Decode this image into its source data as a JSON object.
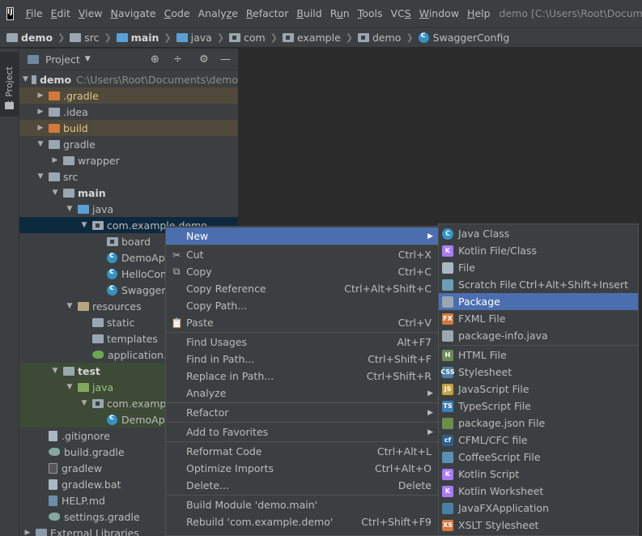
{
  "menubar": {
    "items": [
      {
        "prefix": "",
        "u": "F",
        "rest": "ile"
      },
      {
        "prefix": "",
        "u": "E",
        "rest": "dit"
      },
      {
        "prefix": "",
        "u": "V",
        "rest": "iew"
      },
      {
        "prefix": "",
        "u": "N",
        "rest": "avigate"
      },
      {
        "prefix": "",
        "u": "C",
        "rest": "ode"
      },
      {
        "prefix": "Analy",
        "u": "z",
        "rest": "e"
      },
      {
        "prefix": "",
        "u": "R",
        "rest": "efactor"
      },
      {
        "prefix": "",
        "u": "B",
        "rest": "uild"
      },
      {
        "prefix": "R",
        "u": "u",
        "rest": "n"
      },
      {
        "prefix": "",
        "u": "T",
        "rest": "ools"
      },
      {
        "prefix": "VC",
        "u": "S",
        "rest": ""
      },
      {
        "prefix": "",
        "u": "W",
        "rest": "indow"
      },
      {
        "prefix": "",
        "u": "H",
        "rest": "elp"
      }
    ],
    "window_title": "demo [C:\\Users\\Root\\Documents\\demo]"
  },
  "breadcrumb": [
    "demo",
    "src",
    "main",
    "java",
    "com",
    "example",
    "demo",
    "SwaggerConfig"
  ],
  "tool_window": {
    "tab_label": "1: Project"
  },
  "project_panel": {
    "title": "Project",
    "tree": [
      {
        "label": "demo",
        "path": "C:\\Users\\Root\\Documents\\demo"
      },
      {
        "label": ".gradle"
      },
      {
        "label": ".idea"
      },
      {
        "label": "build"
      },
      {
        "label": "gradle"
      },
      {
        "label": "wrapper"
      },
      {
        "label": "src"
      },
      {
        "label": "main"
      },
      {
        "label": "java"
      },
      {
        "label": "com.example.demo"
      },
      {
        "label": "board"
      },
      {
        "label": "DemoApp"
      },
      {
        "label": "HelloCont"
      },
      {
        "label": "SwaggerC"
      },
      {
        "label": "resources"
      },
      {
        "label": "static"
      },
      {
        "label": "templates"
      },
      {
        "label": "application.p"
      },
      {
        "label": "test"
      },
      {
        "label": "java"
      },
      {
        "label": "com.example"
      },
      {
        "label": "DemoApp"
      },
      {
        "label": ".gitignore"
      },
      {
        "label": "build.gradle"
      },
      {
        "label": "gradlew"
      },
      {
        "label": "gradlew.bat"
      },
      {
        "label": "HELP.md"
      },
      {
        "label": "settings.gradle"
      },
      {
        "label": "External Libraries"
      }
    ]
  },
  "context_menu": {
    "items": [
      {
        "label": "New",
        "shortcut": "",
        "icon": ""
      },
      {
        "label": "Cut",
        "shortcut": "Ctrl+X",
        "icon": "✂"
      },
      {
        "label": "Copy",
        "shortcut": "Ctrl+C",
        "icon": "⧉"
      },
      {
        "label": "Copy Reference",
        "shortcut": "Ctrl+Alt+Shift+C",
        "icon": ""
      },
      {
        "label": "Copy Path...",
        "shortcut": "",
        "icon": ""
      },
      {
        "label": "Paste",
        "shortcut": "Ctrl+V",
        "icon": "📋"
      },
      {
        "label": "Find Usages",
        "shortcut": "Alt+F7",
        "icon": ""
      },
      {
        "label": "Find in Path...",
        "shortcut": "Ctrl+Shift+F",
        "icon": ""
      },
      {
        "label": "Replace in Path...",
        "shortcut": "Ctrl+Shift+R",
        "icon": ""
      },
      {
        "label": "Analyze",
        "shortcut": "",
        "icon": ""
      },
      {
        "label": "Refactor",
        "shortcut": "",
        "icon": ""
      },
      {
        "label": "Add to Favorites",
        "shortcut": "",
        "icon": ""
      },
      {
        "label": "Reformat Code",
        "shortcut": "Ctrl+Alt+L",
        "icon": ""
      },
      {
        "label": "Optimize Imports",
        "shortcut": "Ctrl+Alt+O",
        "icon": ""
      },
      {
        "label": "Delete...",
        "shortcut": "Delete",
        "icon": ""
      },
      {
        "label": "Build Module 'demo.main'",
        "shortcut": "",
        "icon": ""
      },
      {
        "label": "Rebuild 'com.example.demo'",
        "shortcut": "Ctrl+Shift+F9",
        "icon": ""
      }
    ]
  },
  "new_submenu": {
    "items": [
      {
        "label": "Java Class",
        "shortcut": "",
        "icon": "java-class-icon",
        "color": "#3592c4",
        "glyph": "C"
      },
      {
        "label": "Kotlin File/Class",
        "shortcut": "",
        "icon": "kotlin-file-icon",
        "color": "#a97bff",
        "glyph": "K"
      },
      {
        "label": "File",
        "shortcut": "",
        "icon": "file-icon",
        "color": "#a9b7c6",
        "glyph": ""
      },
      {
        "label": "Scratch File",
        "shortcut": "Ctrl+Alt+Shift+Insert",
        "icon": "scratch-file-icon",
        "color": "#6a9fb5",
        "glyph": ""
      },
      {
        "label": "Package",
        "shortcut": "",
        "icon": "package-icon",
        "color": "#9aa7b0",
        "glyph": ""
      },
      {
        "label": "FXML File",
        "shortcut": "",
        "icon": "fxml-file-icon",
        "color": "#d3793d",
        "glyph": "FX"
      },
      {
        "label": "package-info.java",
        "shortcut": "",
        "icon": "package-info-icon",
        "color": "#9aa7b0",
        "glyph": ""
      },
      {
        "label": "HTML File",
        "shortcut": "",
        "icon": "html-file-icon",
        "color": "#6c8a5a",
        "glyph": "H"
      },
      {
        "label": "Stylesheet",
        "shortcut": "",
        "icon": "css-file-icon",
        "color": "#4a7fa8",
        "glyph": "CSS"
      },
      {
        "label": "JavaScript File",
        "shortcut": "",
        "icon": "js-file-icon",
        "color": "#c2a23a",
        "glyph": "JS"
      },
      {
        "label": "TypeScript File",
        "shortcut": "",
        "icon": "ts-file-icon",
        "color": "#3d7fb8",
        "glyph": "TS"
      },
      {
        "label": "package.json File",
        "shortcut": "",
        "icon": "nodejs-icon",
        "color": "#6b8f4a",
        "glyph": ""
      },
      {
        "label": "CFML/CFC file",
        "shortcut": "",
        "icon": "cfml-file-icon",
        "color": "#2d5f8a",
        "glyph": "cf"
      },
      {
        "label": "CoffeeScript File",
        "shortcut": "",
        "icon": "coffee-file-icon",
        "color": "#5a8fb5",
        "glyph": ""
      },
      {
        "label": "Kotlin Script",
        "shortcut": "",
        "icon": "kotlin-script-icon",
        "color": "#a97bff",
        "glyph": "K"
      },
      {
        "label": "Kotlin Worksheet",
        "shortcut": "",
        "icon": "kotlin-worksheet-icon",
        "color": "#a97bff",
        "glyph": "K"
      },
      {
        "label": "JavaFXApplication",
        "shortcut": "",
        "icon": "javafx-icon",
        "color": "#4a7fa8",
        "glyph": ""
      },
      {
        "label": "XSLT Stylesheet",
        "shortcut": "",
        "icon": "xslt-file-icon",
        "color": "#d3793d",
        "glyph": "XS"
      }
    ]
  }
}
